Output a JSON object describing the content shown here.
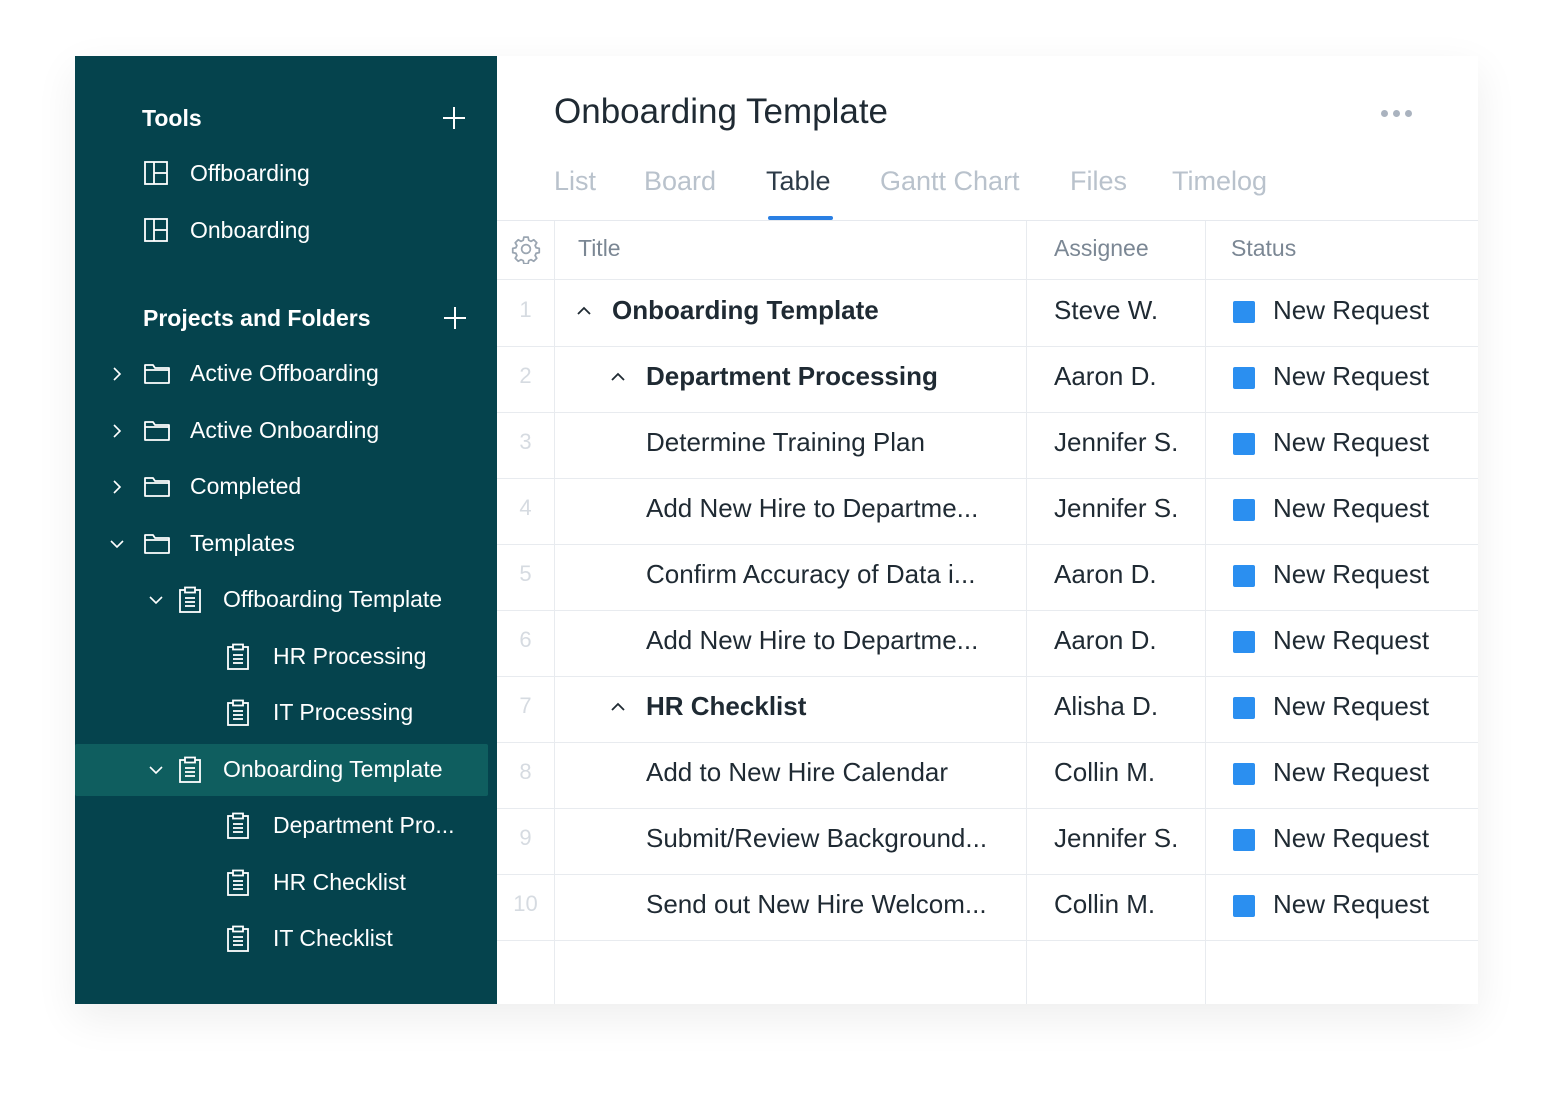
{
  "sidebar": {
    "tools_title": "Tools",
    "tools": [
      {
        "label": "Offboarding",
        "icon": "board-icon"
      },
      {
        "label": "Onboarding",
        "icon": "board-icon"
      }
    ],
    "projects_title": "Projects and Folders",
    "items": [
      {
        "label": "Active Offboarding",
        "icon": "folder-icon",
        "chevron": "right"
      },
      {
        "label": "Active Onboarding",
        "icon": "folder-icon",
        "chevron": "right"
      },
      {
        "label": "Completed",
        "icon": "folder-icon",
        "chevron": "right"
      },
      {
        "label": "Templates",
        "icon": "folder-icon",
        "chevron": "down"
      },
      {
        "label": "Offboarding Template",
        "icon": "clipboard-icon",
        "chevron": "down"
      },
      {
        "label": "HR Processing",
        "icon": "clipboard-icon",
        "chevron": "none"
      },
      {
        "label": "IT Processing",
        "icon": "clipboard-icon",
        "chevron": "none"
      },
      {
        "label": "Onboarding Template",
        "icon": "clipboard-icon",
        "chevron": "down",
        "selected": true
      },
      {
        "label": "Department Pro...",
        "icon": "clipboard-icon",
        "chevron": "none"
      },
      {
        "label": "HR Checklist",
        "icon": "clipboard-icon",
        "chevron": "none"
      },
      {
        "label": "IT Checklist",
        "icon": "clipboard-icon",
        "chevron": "none"
      }
    ]
  },
  "main": {
    "title": "Onboarding Template",
    "tabs": [
      {
        "label": "List"
      },
      {
        "label": "Board"
      },
      {
        "label": "Table",
        "active": true
      },
      {
        "label": "Gantt Chart"
      },
      {
        "label": "Files"
      },
      {
        "label": "Timelog"
      }
    ],
    "columns": {
      "title": "Title",
      "assignee": "Assignee",
      "status": "Status"
    },
    "rows": [
      {
        "num": "1",
        "title": "Onboarding Template",
        "assignee": "Steve W.",
        "status": "New Request",
        "bold": true,
        "toggle": true
      },
      {
        "num": "2",
        "title": "Department Processing",
        "assignee": "Aaron D.",
        "status": "New Request",
        "bold": true,
        "toggle": true
      },
      {
        "num": "3",
        "title": "Determine Training Plan",
        "assignee": "Jennifer S.",
        "status": "New Request"
      },
      {
        "num": "4",
        "title": "Add New Hire to Departme...",
        "assignee": "Jennifer S.",
        "status": "New Request"
      },
      {
        "num": "5",
        "title": "Confirm Accuracy of Data i...",
        "assignee": "Aaron D.",
        "status": "New Request"
      },
      {
        "num": "6",
        "title": "Add New Hire to Departme...",
        "assignee": "Aaron D.",
        "status": "New Request"
      },
      {
        "num": "7",
        "title": "HR Checklist",
        "assignee": "Alisha D.",
        "status": "New Request",
        "bold": true,
        "toggle": true
      },
      {
        "num": "8",
        "title": "Add to New Hire Calendar",
        "assignee": "Collin M.",
        "status": "New Request"
      },
      {
        "num": "9",
        "title": "Submit/Review Background...",
        "assignee": "Jennifer S.",
        "status": "New Request"
      },
      {
        "num": "10",
        "title": "Send out New Hire Welcom...",
        "assignee": "Collin M.",
        "status": "New Request"
      }
    ]
  },
  "colors": {
    "sidebar_bg": "#05434d",
    "sidebar_selected": "#0f5e5f",
    "accent": "#2a7fe3",
    "status_new_request": "#2b8ff0"
  }
}
